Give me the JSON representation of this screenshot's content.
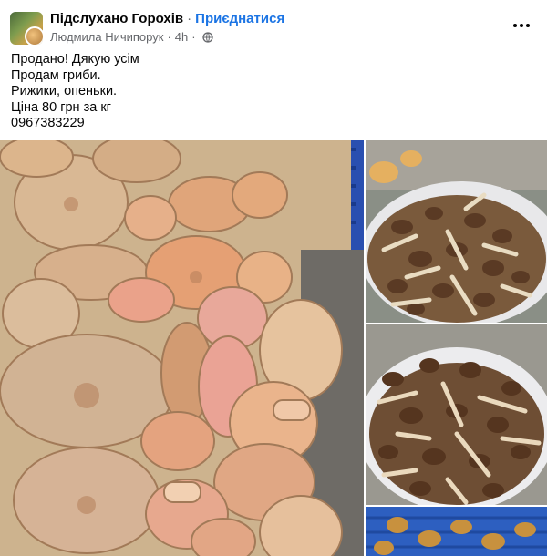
{
  "header": {
    "group_name": "Підслухано Горохів",
    "separator": "·",
    "join_label": "Приєднатися",
    "author": "Людмила Ничипорук",
    "time": "4h"
  },
  "post": {
    "lines": [
      "Продано! Дякую усім",
      "Продам гриби.",
      "Рижики, опеньки.",
      "Ціна 80 грн за кг",
      "0967383229"
    ]
  },
  "icons": {
    "privacy": "globe-icon",
    "menu": "more-dots-icon"
  },
  "colors": {
    "accent": "#1b74e4",
    "secondary_text": "#65676b"
  }
}
